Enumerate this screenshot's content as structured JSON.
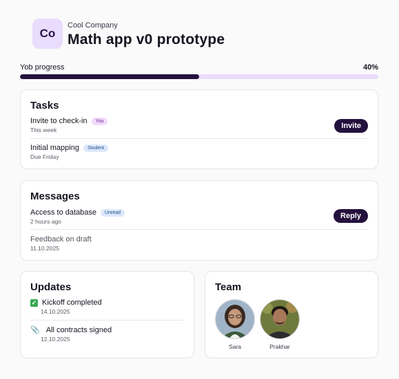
{
  "header": {
    "logo_text": "Co",
    "company": "Cool Company",
    "title": "Math app v0 prototype"
  },
  "progress": {
    "label": "Yob progress",
    "percent_label": "40%",
    "value": 0.5
  },
  "tasks": {
    "title": "Tasks",
    "items": [
      {
        "title": "Invite to check-in",
        "badge": "You",
        "sub": "This week",
        "button": "Invite"
      },
      {
        "title": "Initial mapping",
        "badge": "Student",
        "sub": "Due Friday"
      }
    ]
  },
  "messages": {
    "title": "Messages",
    "items": [
      {
        "title": "Access to database",
        "badge": "Unread",
        "sub": "2 hours ago",
        "button": "Reply"
      },
      {
        "title": "Feedback on draft",
        "sub": "11.10.2025"
      }
    ]
  },
  "updates": {
    "title": "Updates",
    "items": [
      {
        "icon": "check-mark-icon",
        "title": "Kickoff completed",
        "sub": "14.10.2025"
      },
      {
        "icon": "paperclip-icon",
        "title": "All contracts signed",
        "sub": "12.10.2025"
      }
    ]
  },
  "team": {
    "title": "Team",
    "members": [
      {
        "name": "Sara"
      },
      {
        "name": "Prakhar"
      }
    ]
  },
  "colors": {
    "accent": "#24113e",
    "accent_light": "#eadcfd"
  }
}
